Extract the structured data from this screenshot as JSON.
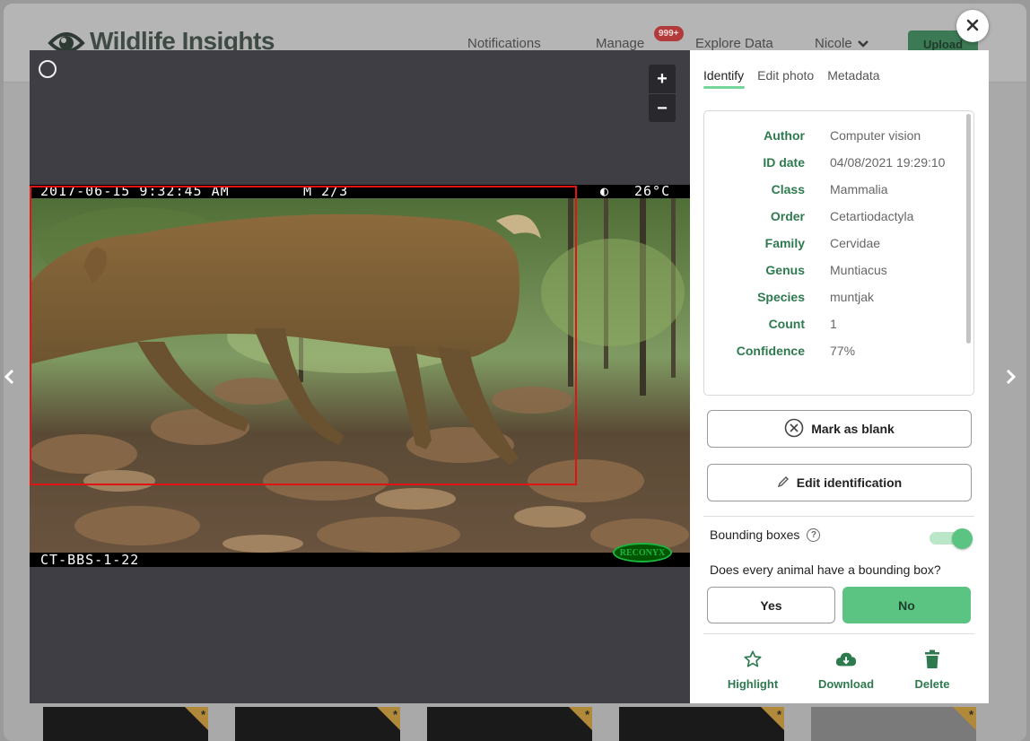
{
  "app": {
    "logo_text": "Wildlife Insights",
    "nav": {
      "notifications": "Notifications",
      "manage": "Manage",
      "manage_badge": "999+",
      "explore": "Explore Data",
      "user": "Nicole",
      "upload": "Upload"
    }
  },
  "viewer": {
    "zoom_in": "+",
    "zoom_out": "−",
    "photo": {
      "timestamp": "2017-06-15 9:32:45 AM",
      "frame": "M 2/3",
      "temperature": "26°C",
      "camera_id": "CT-BBS-1-22",
      "brand": "RECONYX"
    }
  },
  "panel": {
    "tabs": [
      "Identify",
      "Edit photo",
      "Metadata"
    ],
    "details": [
      {
        "label": "Author",
        "value": "Computer vision"
      },
      {
        "label": "ID date",
        "value": "04/08/2021 19:29:10"
      },
      {
        "label": "Class",
        "value": "Mammalia"
      },
      {
        "label": "Order",
        "value": "Cetartiodactyla"
      },
      {
        "label": "Family",
        "value": "Cervidae"
      },
      {
        "label": "Genus",
        "value": "Muntiacus"
      },
      {
        "label": "Species",
        "value": "muntjak"
      },
      {
        "label": "Count",
        "value": "1"
      },
      {
        "label": "Confidence",
        "value": "77%"
      }
    ],
    "mark_blank": "Mark as blank",
    "edit_identification": "Edit identification",
    "bounding_boxes": "Bounding boxes",
    "bounding_boxes_enabled": true,
    "question": "Does every animal have a bounding box?",
    "yes": "Yes",
    "no": "No",
    "actions": {
      "highlight": "Highlight",
      "download": "Download",
      "delete": "Delete"
    }
  },
  "colors": {
    "accent_green": "#5cc483",
    "label_green": "#2e7a4f",
    "bbox_red": "#e01414"
  }
}
